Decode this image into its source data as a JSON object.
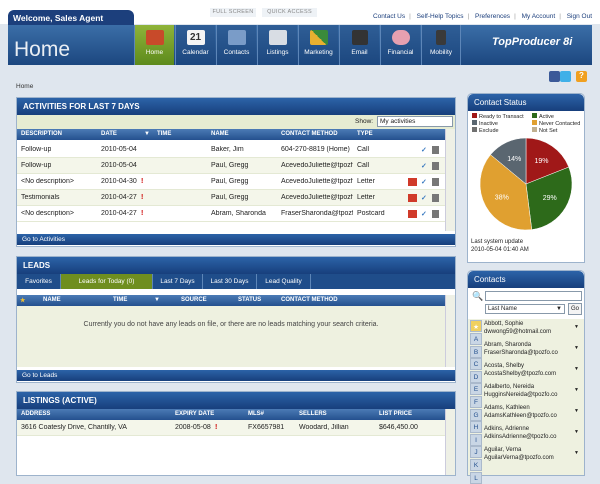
{
  "top": {
    "welcome": "Welcome, Sales Agent",
    "full_screen": "FULL SCREEN",
    "quick_access": "QUICK ACCESS",
    "links": [
      "Contact Us",
      "Self-Help Topics",
      "Preferences",
      "My Account",
      "Sign Out"
    ]
  },
  "header": {
    "title": "Home",
    "brand": "TopProducer",
    "brand_version": "8i",
    "nav": [
      {
        "label": "Home",
        "icon": "home-icon"
      },
      {
        "label": "Calendar",
        "icon": "calendar-icon"
      },
      {
        "label": "Contacts",
        "icon": "contacts-icon"
      },
      {
        "label": "Listings",
        "icon": "listings-icon"
      },
      {
        "label": "Marketing",
        "icon": "marketing-icon"
      },
      {
        "label": "Email",
        "icon": "email-icon"
      },
      {
        "label": "Financial",
        "icon": "financial-icon"
      },
      {
        "label": "Mobility",
        "icon": "mobility-icon"
      }
    ]
  },
  "breadcrumb": "Home",
  "activities": {
    "title": "ACTIVITIES FOR LAST 7 DAYS",
    "show_label": "Show:",
    "show_value": "My activities",
    "columns": [
      "DESCRIPTION",
      "DATE",
      "TIME",
      "NAME",
      "CONTACT METHOD",
      "TYPE"
    ],
    "rows": [
      {
        "desc": "Follow-up",
        "date": "2010-05-04",
        "time": "",
        "name": "Baker, Jim",
        "method": "604-270-8819 (Home)",
        "type": "Call",
        "urgent": false,
        "pdf": false
      },
      {
        "desc": "Follow-up",
        "date": "2010-05-04",
        "time": "",
        "name": "Paul, Gregg",
        "method": "AcevedoJuliette@tpozfo",
        "type": "Call",
        "urgent": false,
        "pdf": false
      },
      {
        "desc": "<No description>",
        "date": "2010-04-30",
        "time": "",
        "name": "Paul, Gregg",
        "method": "AcevedoJuliette@tpozfo",
        "type": "Letter",
        "urgent": true,
        "pdf": true
      },
      {
        "desc": "Testimonials",
        "date": "2010-04-27",
        "time": "",
        "name": "Paul, Gregg",
        "method": "AcevedoJuliette@tpozfo",
        "type": "Letter",
        "urgent": true,
        "pdf": true
      },
      {
        "desc": "<No description>",
        "date": "2010-04-27",
        "time": "",
        "name": "Abram, Sharonda",
        "method": "FraserSharonda@tpozfo",
        "type": "Postcard",
        "urgent": true,
        "pdf": true
      }
    ],
    "footer": "Go to Activities"
  },
  "leads": {
    "title": "LEADS",
    "tabs": [
      "Favorites",
      "Leads for Today (0)",
      "Last 7 Days",
      "Last 30 Days",
      "Lead Quality"
    ],
    "columns": [
      "NAME",
      "TIME",
      "SOURCE",
      "STATUS",
      "CONTACT METHOD"
    ],
    "empty": "Currently you do not have any leads on file, or there are no leads matching your search criteria.",
    "footer": "Go to Leads"
  },
  "listings": {
    "title": "LISTINGS (ACTIVE)",
    "columns": [
      "ADDRESS",
      "EXPIRY DATE",
      "MLS#",
      "SELLERS",
      "LIST PRICE"
    ],
    "rows": [
      {
        "address": "3616 Coatesly Drive, Chantilly, VA",
        "expiry": "2008-05-08",
        "mls": "FX6657981",
        "sellers": "Woodard, Jillian",
        "price": "$646,450.00"
      }
    ]
  },
  "contact_status": {
    "title": "Contact Status",
    "legend": [
      {
        "label": "Ready to Transact",
        "color": "#a01818"
      },
      {
        "label": "Active",
        "color": "#2d6a1a"
      },
      {
        "label": "Inactive",
        "color": "#5a6670"
      },
      {
        "label": "Never Contacted",
        "color": "#e0a030"
      },
      {
        "label": "Exclude",
        "color": "#707070"
      },
      {
        "label": "Not Set",
        "color": "#c0b090"
      }
    ],
    "update_label": "Last system update",
    "update_time": "2010-05-04 01:40 AM"
  },
  "chart_data": {
    "type": "pie",
    "values": [
      {
        "label": "Ready to Transact",
        "value": 19
      },
      {
        "label": "Active",
        "value": 29
      },
      {
        "label": "Never Contacted",
        "value": 38
      },
      {
        "label": "Inactive",
        "value": 14
      }
    ]
  },
  "contacts": {
    "title": "Contacts",
    "sort_value": "Last Name",
    "go": "Go",
    "letters": [
      "A",
      "B",
      "C",
      "D",
      "E",
      "F",
      "G",
      "H",
      "I",
      "J",
      "K",
      "L"
    ],
    "items": [
      {
        "name": "Abbott, Sophie",
        "email": "dwwong59@hotmail.com"
      },
      {
        "name": "Abram, Sharonda",
        "email": "FraserSharonda@tpozfo.co"
      },
      {
        "name": "Acosta, Shelby",
        "email": "AcostaShelby@tpozfo.com"
      },
      {
        "name": "Adalberto, Nereida",
        "email": "HugginsNereida@tpozfo.co"
      },
      {
        "name": "Adams, Kathleen",
        "email": "AdamsKathleen@tpozfo.co"
      },
      {
        "name": "Adkins, Adrienne",
        "email": "AdkinsAdrienne@tpozfo.co"
      },
      {
        "name": "Aguilar, Verna",
        "email": "AguilarVerna@tpozfo.com"
      }
    ]
  }
}
